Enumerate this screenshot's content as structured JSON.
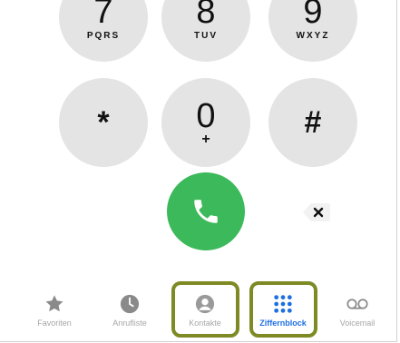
{
  "keypad": {
    "keys": [
      {
        "digit": "7",
        "letters": "PQRS"
      },
      {
        "digit": "8",
        "letters": "TUV"
      },
      {
        "digit": "9",
        "letters": "WXYZ"
      },
      {
        "digit": "*",
        "letters": ""
      },
      {
        "digit": "0",
        "letters": "+"
      },
      {
        "digit": "#",
        "letters": ""
      }
    ]
  },
  "actions": {
    "call_icon": "phone-icon",
    "delete_icon": "delete-backspace-icon",
    "call_color": "#3cb95a"
  },
  "tabbar": {
    "tabs": [
      {
        "label": "Favoriten",
        "icon": "star-icon",
        "active": false
      },
      {
        "label": "Anrufliste",
        "icon": "clock-icon",
        "active": false
      },
      {
        "label": "Kontakte",
        "icon": "contact-icon",
        "active": false
      },
      {
        "label": "Ziffernblock",
        "icon": "keypad-icon",
        "active": true
      },
      {
        "label": "Voicemail",
        "icon": "voicemail-icon",
        "active": false
      }
    ],
    "active_color": "#1f6fe0",
    "inactive_color": "#a7a7a7",
    "highlight_color": "#7e8a24"
  }
}
